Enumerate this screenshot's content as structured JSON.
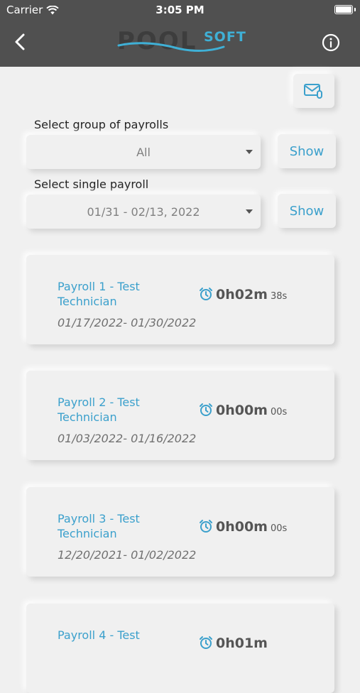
{
  "status": {
    "carrier": "Carrier",
    "time": "3:05 PM"
  },
  "header": {
    "logo_main": "POOL",
    "logo_accent": "SOFT"
  },
  "filters": {
    "group_label": "Select group of payrolls",
    "group_value": "All",
    "single_label": "Select single payroll",
    "single_value": "01/31 - 02/13, 2022",
    "show_label": "Show"
  },
  "payrolls": [
    {
      "title": "Payroll 1 - Test Technician",
      "dates": "01/17/2022- 01/30/2022",
      "hm": "0h02m",
      "s": "38s"
    },
    {
      "title": "Payroll 2 - Test Technician",
      "dates": "01/03/2022- 01/16/2022",
      "hm": "0h00m",
      "s": "00s"
    },
    {
      "title": "Payroll 3 - Test Technician",
      "dates": "12/20/2021- 01/02/2022",
      "hm": "0h00m",
      "s": "00s"
    },
    {
      "title": "Payroll 4 - Test",
      "dates": "",
      "hm": "0h01m",
      "s": ""
    }
  ],
  "colors": {
    "accent": "#3ba0cc",
    "bar": "#505050",
    "background": "#f0f0f0"
  },
  "icons": [
    "wifi-icon",
    "battery-icon",
    "back-chevron-icon",
    "info-icon",
    "email-attachment-icon",
    "alarm-clock-icon",
    "dropdown-caret-icon"
  ]
}
